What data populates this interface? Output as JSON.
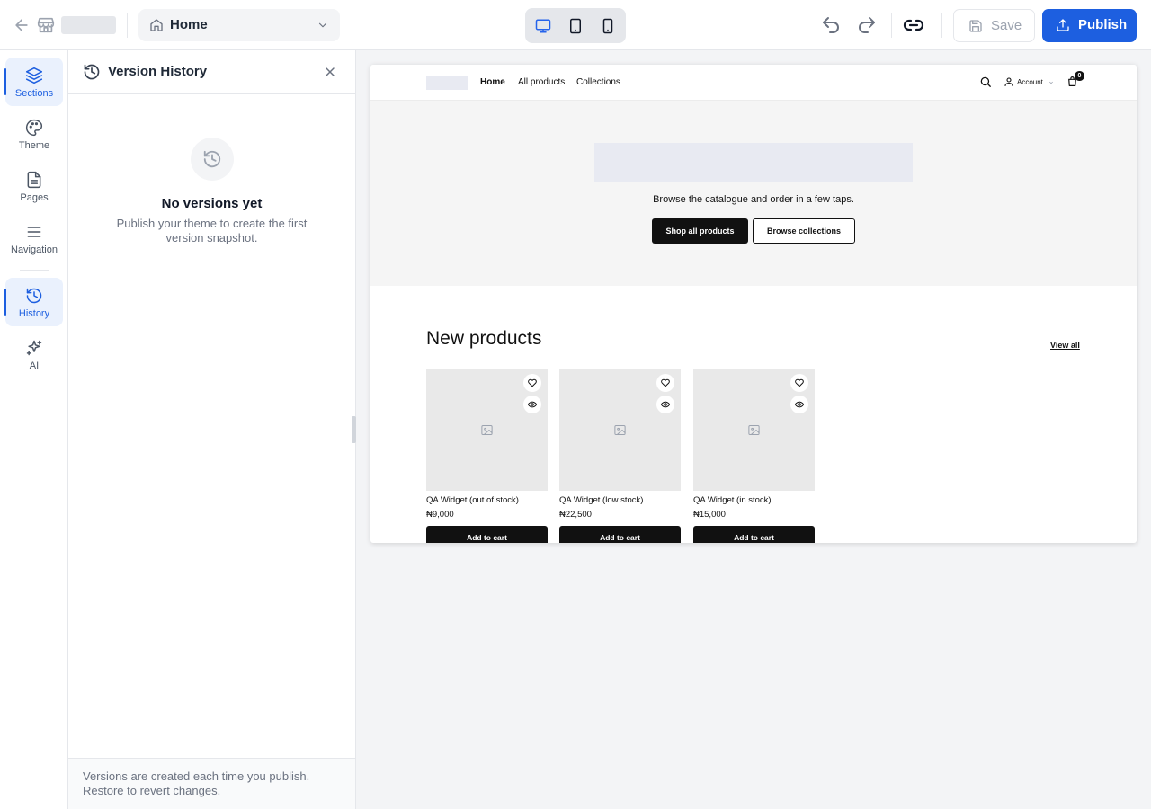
{
  "topbar": {
    "page_select": {
      "label": "Home"
    },
    "device_modes": [
      "desktop",
      "tablet",
      "mobile"
    ],
    "active_device": "desktop",
    "save_label": "Save",
    "publish_label": "Publish"
  },
  "rail": {
    "items": [
      {
        "id": "sections",
        "label": "Sections",
        "icon": "layers-icon"
      },
      {
        "id": "theme",
        "label": "Theme",
        "icon": "palette-icon"
      },
      {
        "id": "pages",
        "label": "Pages",
        "icon": "file-icon"
      },
      {
        "id": "navigation",
        "label": "Navigation",
        "icon": "menu-icon"
      },
      {
        "id": "history",
        "label": "History",
        "icon": "history-icon"
      },
      {
        "id": "ai",
        "label": "AI",
        "icon": "sparkles-icon"
      }
    ],
    "active": [
      "sections",
      "history"
    ]
  },
  "panel": {
    "title": "Version History",
    "empty_title": "No versions yet",
    "empty_desc": "Publish your theme to create the first version snapshot.",
    "footer": "Versions are created each time you publish. Restore to revert changes."
  },
  "storefront": {
    "nav": [
      "Home",
      "All products",
      "Collections"
    ],
    "account_label": "Account",
    "cart_count": "0",
    "hero": {
      "subtitle": "Browse the catalogue and order in a few taps.",
      "primary_cta": "Shop all products",
      "secondary_cta": "Browse collections"
    },
    "new_products": {
      "title": "New products",
      "view_all": "View all",
      "add_to_cart": "Add to cart",
      "items": [
        {
          "name": "QA Widget (out of stock)",
          "price": "₦9,000"
        },
        {
          "name": "QA Widget (low stock)",
          "price": "₦22,500"
        },
        {
          "name": "QA Widget (in stock)",
          "price": "₦15,000"
        }
      ]
    }
  },
  "colors": {
    "accent": "#1d5fe0",
    "active_bg": "#eaf1fd",
    "canvas_bg": "#f3f4f6",
    "storefront_button": "#111111"
  }
}
